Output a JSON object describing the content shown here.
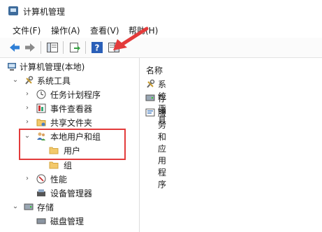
{
  "window": {
    "title": "计算机管理"
  },
  "menu": [
    "文件(F)",
    "操作(A)",
    "查看(V)",
    "帮助(H)"
  ],
  "tree": {
    "root": "计算机管理(本地)",
    "system_tools": "系统工具",
    "task_scheduler": "任务计划程序",
    "event_viewer": "事件查看器",
    "shared_folders": "共享文件夹",
    "local_users_groups": "本地用户和组",
    "users": "用户",
    "groups": "组",
    "performance": "性能",
    "device_manager": "设备管理器",
    "storage": "存储",
    "disk_management": "磁盘管理"
  },
  "right": {
    "column_header": "名称",
    "items": [
      "系统工具",
      "存储",
      "服务和应用程序"
    ]
  },
  "colors": {
    "annotation": "#e33b3b",
    "folder": "#f3c96b",
    "accent": "#2f6fbf"
  }
}
